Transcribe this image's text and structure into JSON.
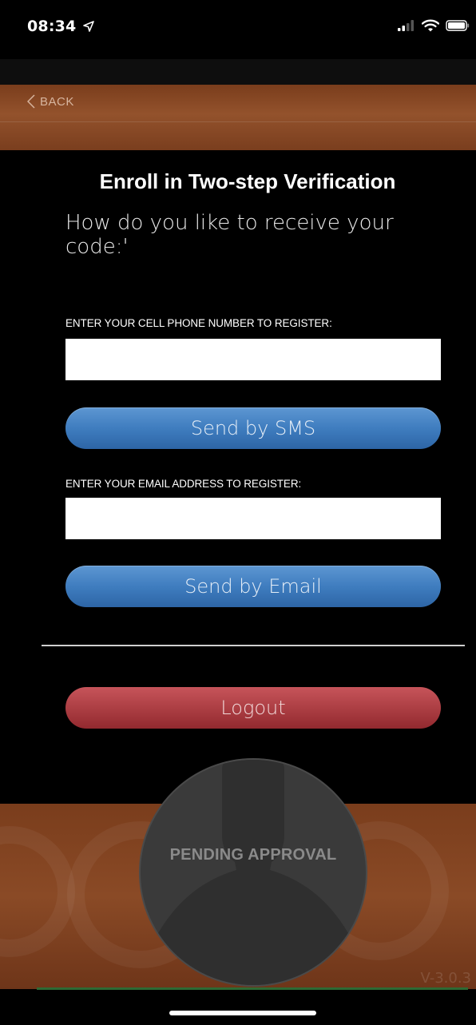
{
  "status_bar": {
    "time": "08:34"
  },
  "nav": {
    "back_label": "BACK"
  },
  "page": {
    "title": "Enroll in Two-step Verification",
    "subtitle": "How do you like to receive your code:'"
  },
  "phone": {
    "label": "ENTER YOUR CELL PHONE NUMBER TO REGISTER:",
    "value": "",
    "button_label": "Send by SMS"
  },
  "email": {
    "label": "ENTER YOUR EMAIL ADDRESS TO REGISTER:",
    "value": "",
    "button_label": "Send by Email"
  },
  "logout_label": "Logout",
  "profile": {
    "status_label": "PENDING APPROVAL"
  },
  "version": "V-3.0.3",
  "colors": {
    "brand_brown": "#7a3d1c",
    "button_blue": "#3f7dbf",
    "button_red": "#ad3f44",
    "background": "#000000"
  }
}
